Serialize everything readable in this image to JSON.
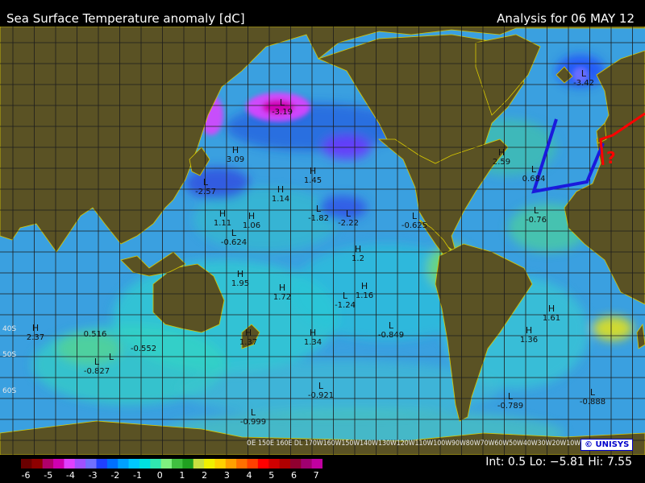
{
  "header": {
    "title": "Sea Surface Temperature anomaly [dC]",
    "analysis": "Analysis for 06 MAY 12"
  },
  "map": {
    "projection": "Mercator (Pacific-centered)",
    "ocean_base_color": "#3aa0e0",
    "land_color": "#5a5224",
    "border_color": "#d8c800",
    "grid_color": "#1c1c1c",
    "lat_labels": [
      "40S",
      "50S",
      "60S"
    ],
    "lon_axis_label": "150E 160E DL 170W160W150W140W130W120W110W100W90W80W70W60W50W40W30W20W10W",
    "lon_axis_left": "0E"
  },
  "markers": [
    {
      "kind": "H",
      "value": "3.09"
    },
    {
      "kind": "L",
      "value": "-3.19"
    },
    {
      "kind": "L",
      "value": "-2.57"
    },
    {
      "kind": "H",
      "value": "1.45"
    },
    {
      "kind": "H",
      "value": "1.14"
    },
    {
      "kind": "H",
      "value": "1.11"
    },
    {
      "kind": "H",
      "value": "1.06"
    },
    {
      "kind": "L",
      "value": "-0.624"
    },
    {
      "kind": "L",
      "value": "-1.82"
    },
    {
      "kind": "L",
      "value": "-2.22"
    },
    {
      "kind": "L",
      "value": "-0.625"
    },
    {
      "kind": "H",
      "value": "2.59"
    },
    {
      "kind": "L",
      "value": "0.684"
    },
    {
      "kind": "L",
      "value": "-0.76"
    },
    {
      "kind": "L",
      "value": "-3.42"
    },
    {
      "kind": "H",
      "value": "1.2"
    },
    {
      "kind": "H",
      "value": "1.95"
    },
    {
      "kind": "H",
      "value": "1.72"
    },
    {
      "kind": "L",
      "value": "-1.24"
    },
    {
      "kind": "H",
      "value": "1.16"
    },
    {
      "kind": "H",
      "value": "2.37"
    },
    {
      "kind": "",
      "value": "0.516"
    },
    {
      "kind": "",
      "value": "-0.552"
    },
    {
      "kind": "L",
      "value": "-0.827"
    },
    {
      "kind": "H",
      "value": "1.37"
    },
    {
      "kind": "H",
      "value": "1.34"
    },
    {
      "kind": "L",
      "value": "-0.849"
    },
    {
      "kind": "H",
      "value": "1.36"
    },
    {
      "kind": "H",
      "value": "1.61"
    },
    {
      "kind": "L",
      "value": "-0.921"
    },
    {
      "kind": "L",
      "value": "-0.999"
    },
    {
      "kind": "L",
      "value": "-0.789"
    },
    {
      "kind": "L",
      "value": "-0.888"
    },
    {
      "kind": "L",
      "value": ""
    }
  ],
  "annotations": {
    "question_marks": "?",
    "europe_line_color": "#ff0000",
    "atlantic_box_color": "#1a1adc"
  },
  "colorbar": {
    "ticks": [
      "-6",
      "-5",
      "-4",
      "-3",
      "-2",
      "-1",
      "0",
      "1",
      "2",
      "3",
      "4",
      "5",
      "6",
      "7"
    ],
    "colors": [
      "#6a0000",
      "#8e0000",
      "#b0006a",
      "#d000b0",
      "#e040ff",
      "#a050ff",
      "#7070ff",
      "#2040ff",
      "#0070ff",
      "#00a0ff",
      "#00c8ff",
      "#00e0e0",
      "#30e8b0",
      "#80f080",
      "#40c040",
      "#20a020",
      "#c8e040",
      "#f0f000",
      "#ffd000",
      "#ffa000",
      "#ff7000",
      "#ff4000",
      "#ff0000",
      "#d00000",
      "#b00000",
      "#900030",
      "#a00070",
      "#c000a0"
    ]
  },
  "stats": {
    "text": "Int: 0.5 Lo: −5.81 Hi: 7.55"
  },
  "logo": {
    "text": "© UNISYS"
  }
}
